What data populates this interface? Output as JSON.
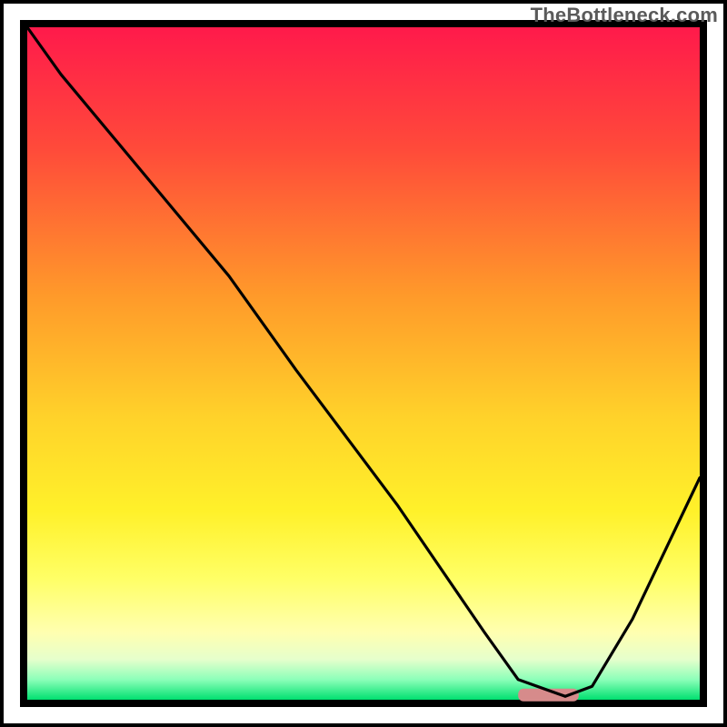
{
  "watermark": "TheBottleneck.com",
  "chart_data": {
    "type": "line",
    "title": "",
    "xlabel": "",
    "ylabel": "",
    "xlim": [
      0,
      100
    ],
    "ylim": [
      0,
      100
    ],
    "gradient_stops": [
      {
        "offset": 0,
        "color": "#ff1a4b"
      },
      {
        "offset": 18,
        "color": "#ff4a3a"
      },
      {
        "offset": 40,
        "color": "#ff9a2a"
      },
      {
        "offset": 58,
        "color": "#ffd22a"
      },
      {
        "offset": 72,
        "color": "#fff12a"
      },
      {
        "offset": 82,
        "color": "#ffff66"
      },
      {
        "offset": 90,
        "color": "#ffffb0"
      },
      {
        "offset": 94,
        "color": "#e6ffcc"
      },
      {
        "offset": 97,
        "color": "#8cffb9"
      },
      {
        "offset": 100,
        "color": "#00e070"
      }
    ],
    "series": [
      {
        "name": "bottleneck-curve",
        "type": "line",
        "color": "#000000",
        "x": [
          0,
          5,
          20,
          30,
          40,
          55,
          68,
          73,
          80,
          84,
          90,
          100
        ],
        "y": [
          100,
          93,
          75,
          63,
          49,
          29,
          10,
          3,
          0.5,
          2,
          12,
          33
        ]
      }
    ],
    "valley_marker": {
      "x_start": 73,
      "x_end": 82,
      "y": 0.7,
      "color": "#d68b8b"
    }
  }
}
